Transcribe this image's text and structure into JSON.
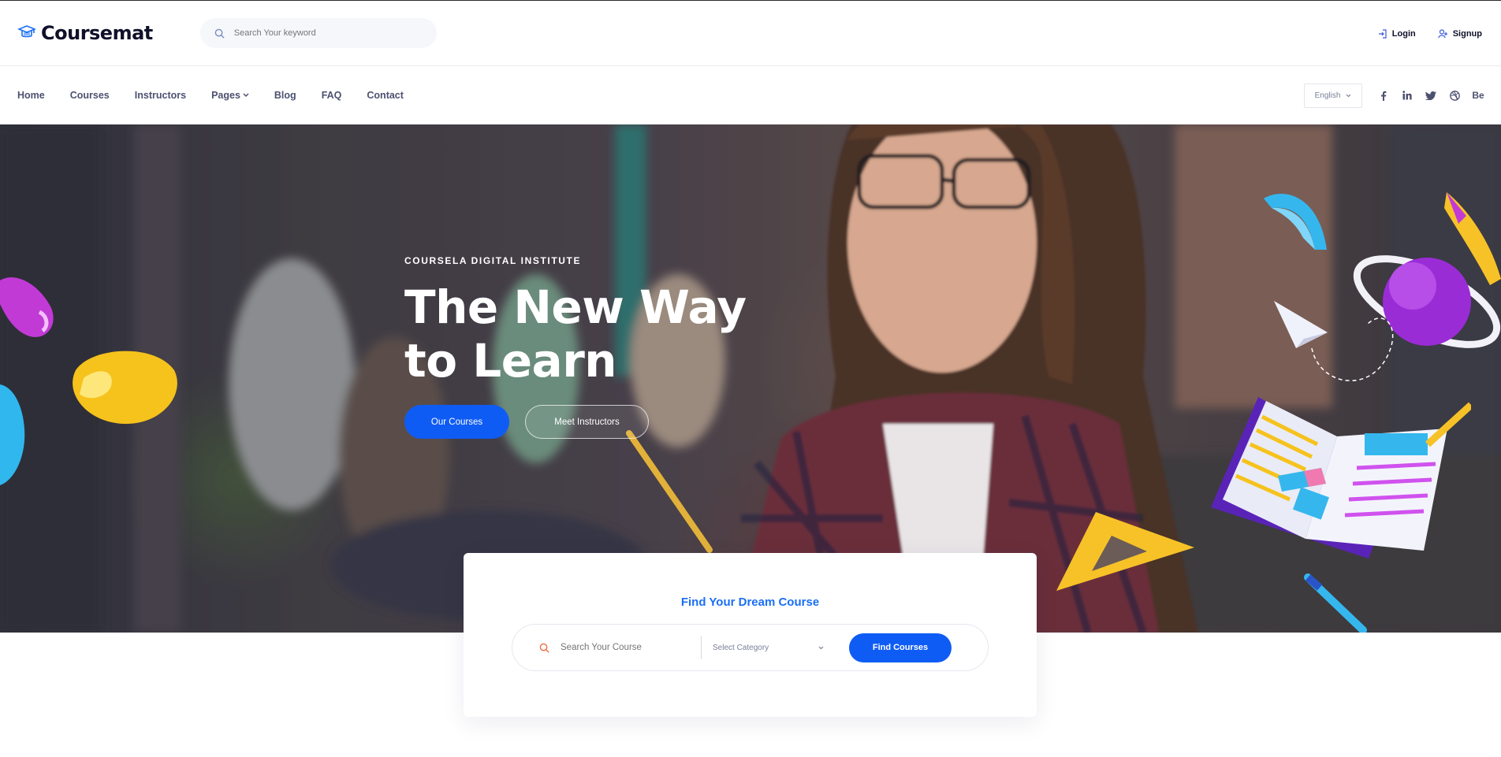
{
  "brand": {
    "name": "Coursemat"
  },
  "header": {
    "search_placeholder": "Search Your keyword",
    "login": "Login",
    "signup": "Signup"
  },
  "nav": {
    "items": [
      "Home",
      "Courses",
      "Instructors",
      "Pages",
      "Blog",
      "FAQ",
      "Contact"
    ],
    "language": "English",
    "social_icons": [
      "facebook-icon",
      "linkedin-icon",
      "twitter-icon",
      "dribbble-icon",
      "behance-icon"
    ],
    "behance_label": "Be"
  },
  "hero": {
    "kicker": "COURSELA DIGITAL INSTITUTE",
    "title_line1": "The New Way",
    "title_line2": "to Learn",
    "primary_button": "Our Courses",
    "secondary_button": "Meet Instructors"
  },
  "finder": {
    "title": "Find Your Dream Course",
    "search_placeholder": "Search Your Course",
    "category": "Select Category",
    "button": "Find Courses"
  },
  "colors": {
    "accent": "#0f5cf5",
    "title_blue": "#1a6ef5",
    "text_dark": "#0f1029"
  }
}
